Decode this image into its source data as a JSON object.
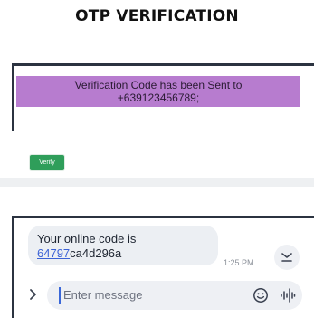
{
  "title": "OTP VERIFICATION",
  "otp": {
    "sent_line1": "Verification Code has been Sent to",
    "sent_line2": "+639123456789;",
    "verify_label": "Verify"
  },
  "message": {
    "line1": "Your online code is",
    "code_link": "64797",
    "code_rest": "ca4d296a",
    "time": "1:25 PM"
  },
  "composer": {
    "placeholder": "Enter message"
  },
  "icons": {
    "collapse": "collapse-down-icon",
    "expand": "chevron-right-icon",
    "emoji": "emoji-icon",
    "voice": "voice-waveform-icon"
  },
  "colors": {
    "banner": "#b77ccf",
    "verify": "#2f9e5a",
    "link": "#3b62d6"
  }
}
